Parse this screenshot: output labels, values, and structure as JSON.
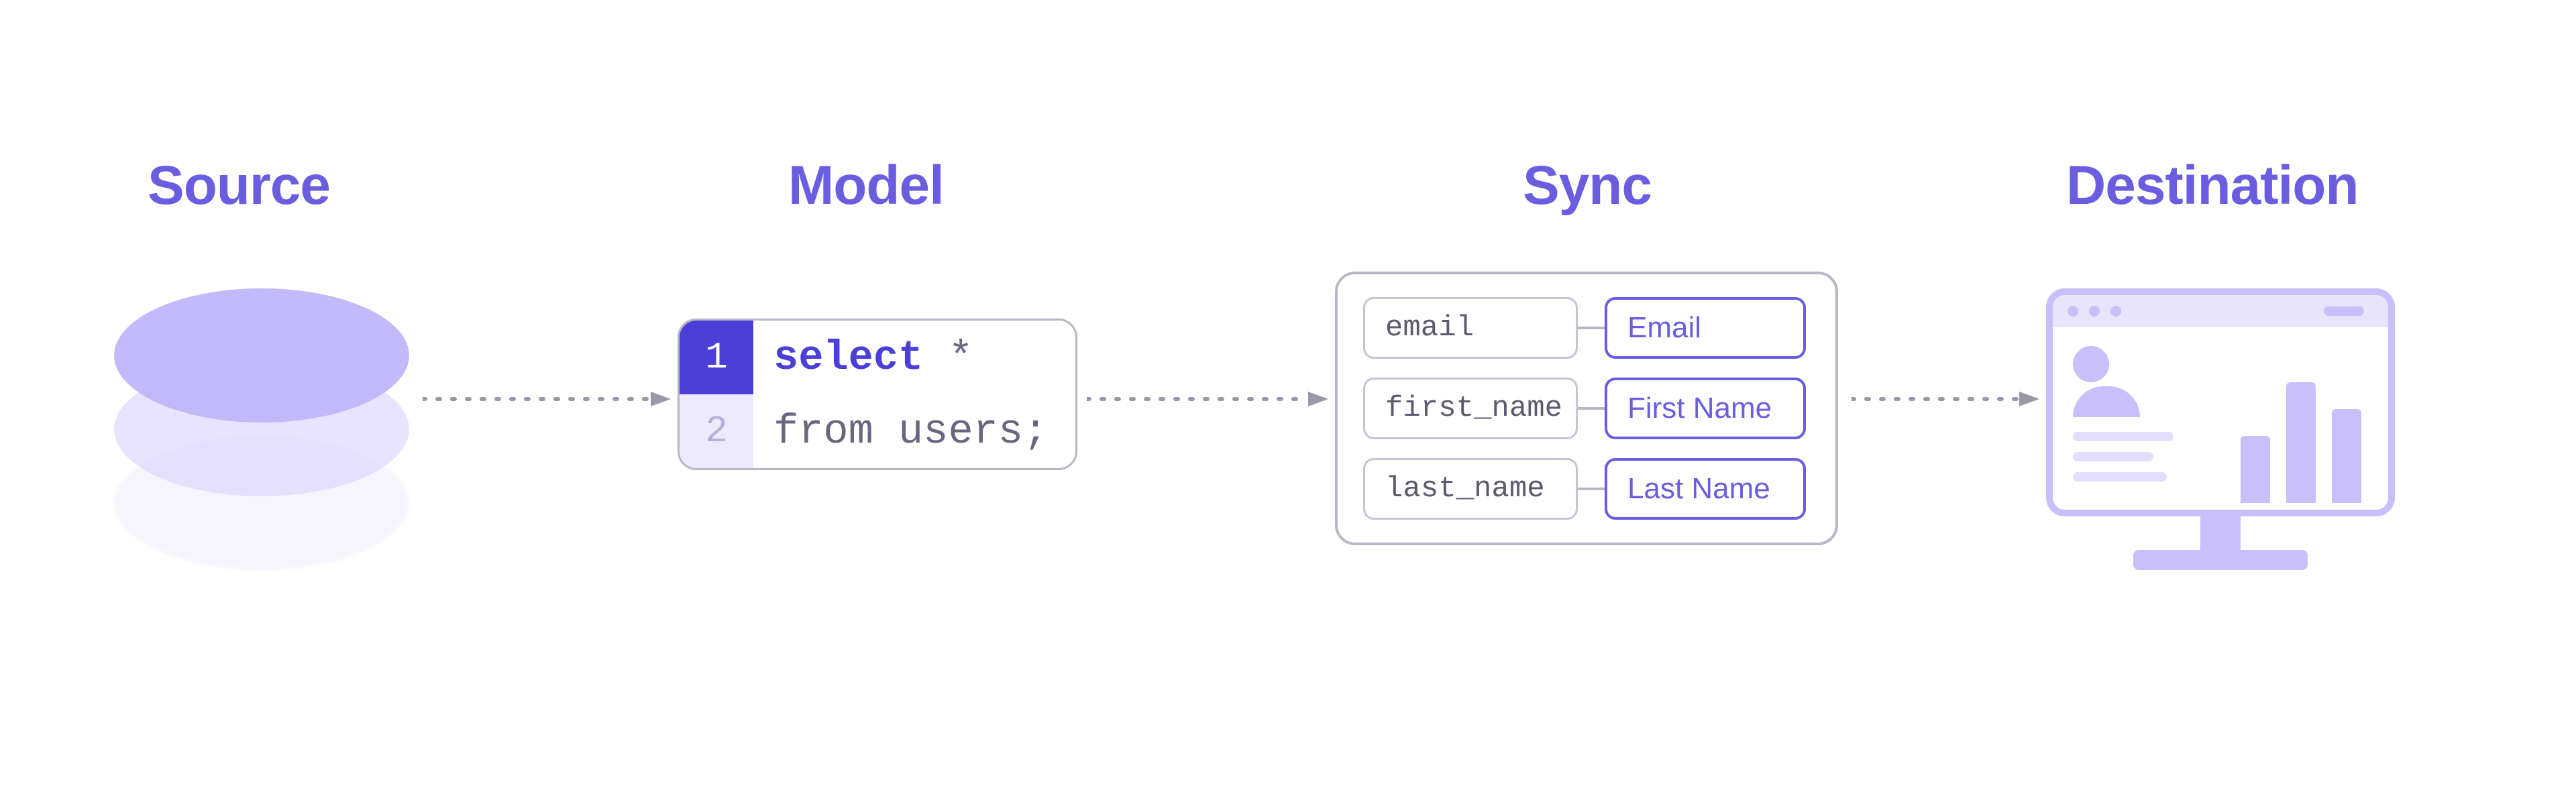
{
  "labels": {
    "source": "Source",
    "model": "Model",
    "sync": "Sync",
    "destination": "Destination"
  },
  "model_code": {
    "line1_num": "1",
    "line1_keyword": "select",
    "line1_rest": " *",
    "line2_num": "2",
    "line2_text": "from users;"
  },
  "sync_mappings": [
    {
      "source_field": "email",
      "dest_field": "Email"
    },
    {
      "source_field": "first_name",
      "dest_field": "First Name"
    },
    {
      "source_field": "last_name",
      "dest_field": "Last Name"
    }
  ],
  "colors": {
    "accent": "#6a5de0",
    "accent_light": "#c8bffb",
    "border_gray": "#b9b6c6"
  }
}
